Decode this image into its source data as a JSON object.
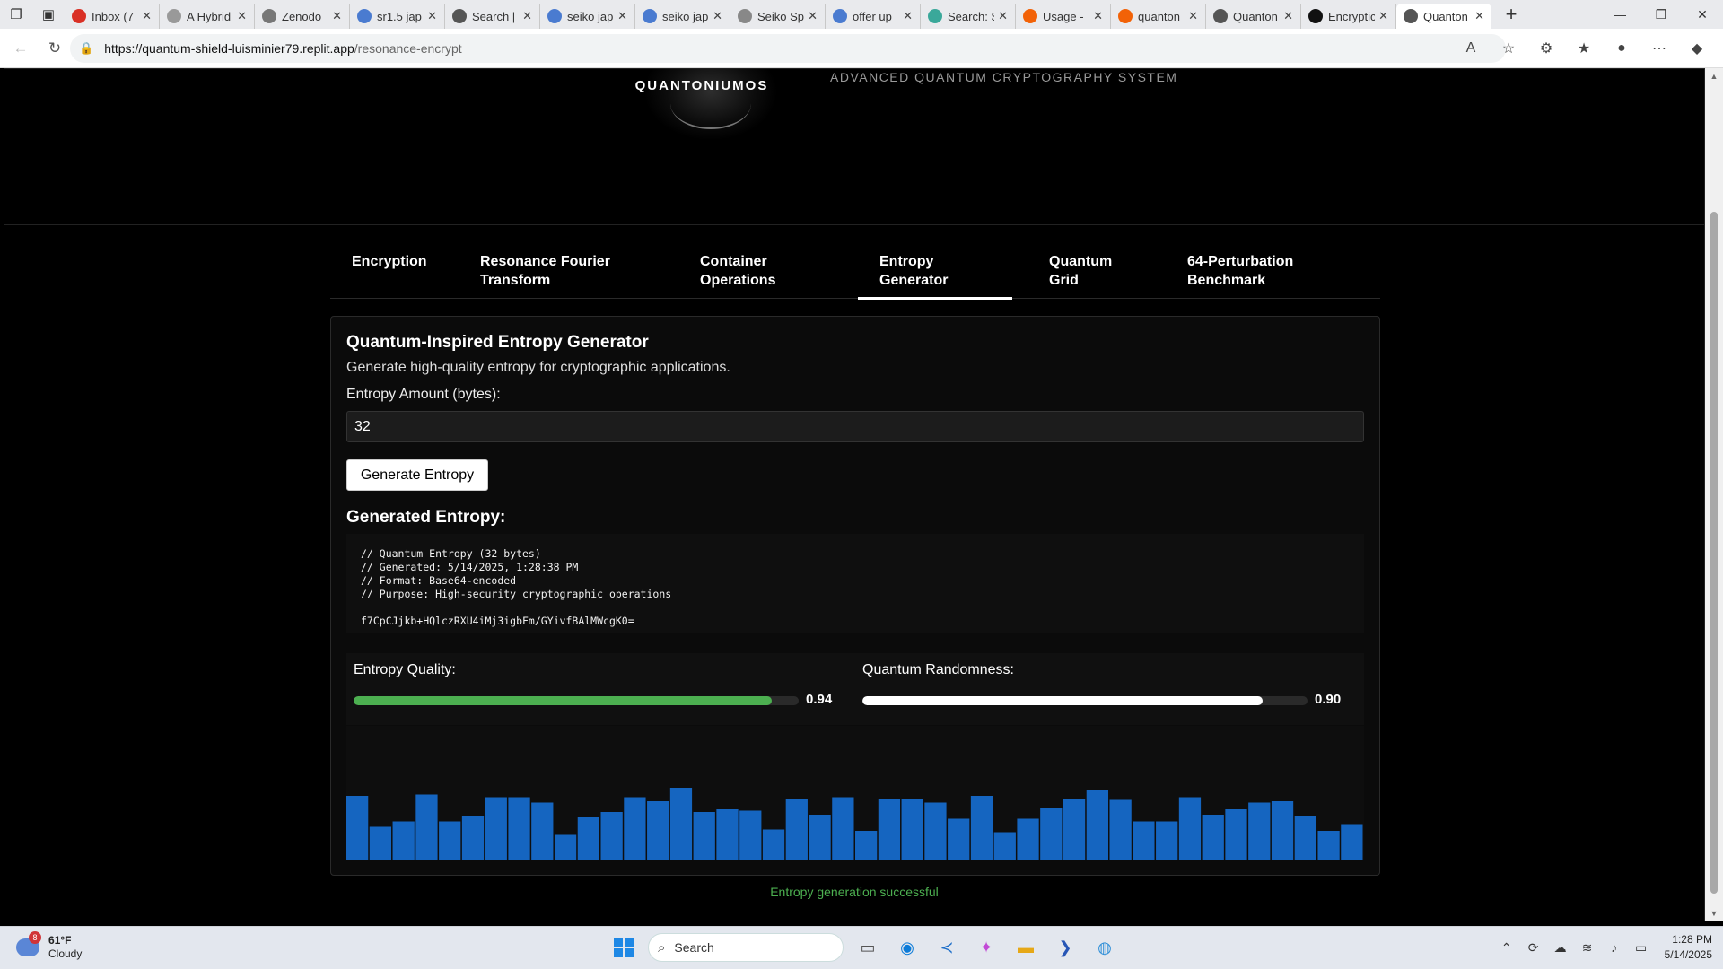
{
  "browser": {
    "tabs": [
      {
        "label": "Inbox (7",
        "favicon": "gmail-icon",
        "color": "#d93025"
      },
      {
        "label": "A Hybrid",
        "favicon": "doc-icon",
        "color": "#999999"
      },
      {
        "label": "Zenodo",
        "favicon": "zenodo-icon",
        "color": "#777777"
      },
      {
        "label": "sr1.5 jap",
        "favicon": "search-icon",
        "color": "#4a7bd0"
      },
      {
        "label": "Search |",
        "favicon": "search-icon",
        "color": "#555555"
      },
      {
        "label": "seiko jap",
        "favicon": "search-icon",
        "color": "#4a7bd0"
      },
      {
        "label": "seiko jap",
        "favicon": "search-icon",
        "color": "#4a7bd0"
      },
      {
        "label": "Seiko Sp",
        "favicon": "loading-icon",
        "color": "#888888"
      },
      {
        "label": "offer up",
        "favicon": "search-icon",
        "color": "#4a7bd0"
      },
      {
        "label": "Search: S",
        "favicon": "perplexity-icon",
        "color": "#3aa89a"
      },
      {
        "label": "Usage -",
        "favicon": "replit-icon",
        "color": "#f26207"
      },
      {
        "label": "quanton",
        "favicon": "replit-icon",
        "color": "#f26207"
      },
      {
        "label": "Quanton",
        "favicon": "globe-icon",
        "color": "#555555"
      },
      {
        "label": "Encryptic",
        "favicon": "q-icon",
        "color": "#111111"
      },
      {
        "label": "Quanton",
        "favicon": "globe-icon",
        "color": "#555555",
        "active": true
      }
    ],
    "url_host": "https://quantum-shield-luisminier79.replit.app",
    "url_path": "/resonance-encrypt"
  },
  "header": {
    "logo_text": "QUANTONIUMOS",
    "subtitle": "ADVANCED QUANTUM CRYPTOGRAPHY SYSTEM"
  },
  "nav_tabs": [
    {
      "line1": "Encryption",
      "line2": ""
    },
    {
      "line1": "Resonance Fourier",
      "line2": "Transform"
    },
    {
      "line1": "Container",
      "line2": "Operations"
    },
    {
      "line1": "Entropy",
      "line2": "Generator",
      "active": true
    },
    {
      "line1": "Quantum",
      "line2": "Grid"
    },
    {
      "line1": "64-Perturbation",
      "line2": "Benchmark"
    }
  ],
  "panel": {
    "title": "Quantum-Inspired Entropy Generator",
    "description": "Generate high-quality entropy for cryptographic applications.",
    "amount_label": "Entropy Amount (bytes):",
    "amount_value": "32",
    "button_label": "Generate Entropy",
    "generated_title": "Generated Entropy:",
    "output_lines": [
      "// Quantum Entropy (32 bytes)",
      "// Generated: 5/14/2025, 1:28:38 PM",
      "// Format: Base64-encoded",
      "// Purpose: High-security cryptographic operations"
    ],
    "output_key": "f7CpCJjkb+HQlczRXU4iMj3igbFm/GYivfBAlMWcgK0="
  },
  "meters": {
    "quality": {
      "label": "Entropy Quality:",
      "value": 0.94,
      "value_text": "0.94",
      "color": "#4caf50"
    },
    "randomness": {
      "label": "Quantum Randomness:",
      "value": 0.9,
      "value_text": "0.90",
      "color": "#ffffff"
    }
  },
  "chart_data": {
    "type": "bar",
    "color": "#1565c0",
    "values": [
      48,
      25,
      29,
      49,
      29,
      33,
      47,
      47,
      43,
      19,
      32,
      36,
      47,
      44,
      54,
      36,
      38,
      37,
      23,
      46,
      34,
      47,
      22,
      46,
      46,
      43,
      31,
      48,
      21,
      31,
      39,
      46,
      52,
      45,
      29,
      29,
      47,
      34,
      38,
      43,
      44,
      33,
      22,
      27
    ],
    "ylim": [
      0,
      100
    ]
  },
  "status": "Entropy generation successful",
  "taskbar": {
    "weather_temp": "61°F",
    "weather_desc": "Cloudy",
    "weather_badge": "8",
    "search_placeholder": "Search",
    "time": "1:28 PM",
    "date": "5/14/2025"
  }
}
